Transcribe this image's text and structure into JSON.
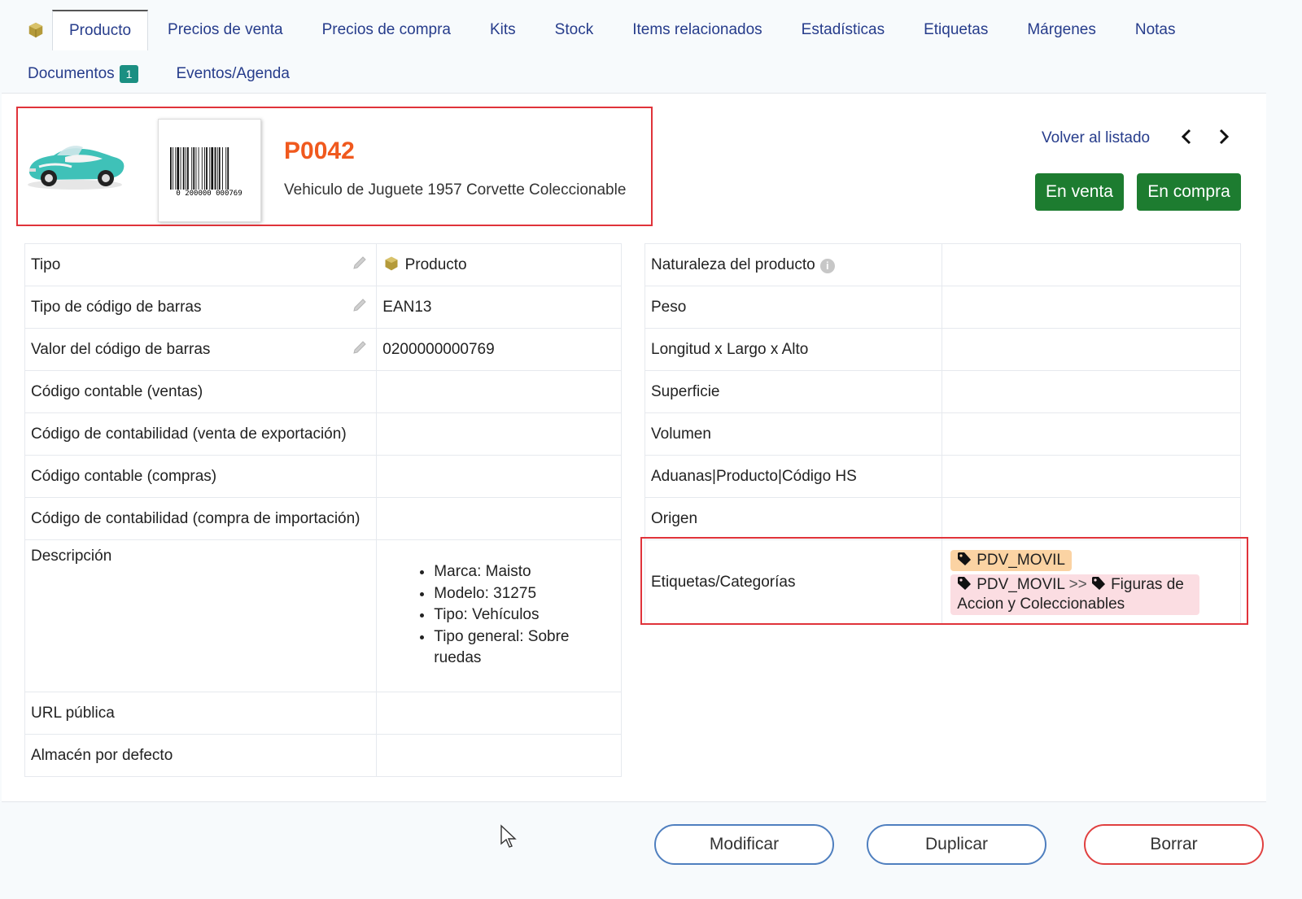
{
  "tabs_row1": [
    "Producto",
    "Precios de venta",
    "Precios de compra",
    "Kits",
    "Stock",
    "Items relacionados",
    "Estadísticas",
    "Etiquetas",
    "Márgenes",
    "Notas"
  ],
  "tabs_row2": {
    "documentos": "Documentos",
    "documentos_count": "1",
    "eventos": "Eventos/Agenda"
  },
  "product": {
    "ref": "P0042",
    "label": "Vehiculo de Juguete 1957 Corvette Coleccionable",
    "barcode_digits": "0 200000 000769"
  },
  "nav": {
    "back": "Volver al listado"
  },
  "status": {
    "sell": "En venta",
    "buy": "En compra"
  },
  "left": {
    "tipo_k": "Tipo",
    "tipo_v": "Producto",
    "barcode_type_k": "Tipo de código de barras",
    "barcode_type_v": "EAN13",
    "barcode_value_k": "Valor del código de barras",
    "barcode_value_v": "0200000000769",
    "acc_sell_k": "Código contable (ventas)",
    "acc_export_k": "Código de contabilidad (venta de exportación)",
    "acc_buy_k": "Código contable (compras)",
    "acc_import_k": "Código de contabilidad (compra de importación)",
    "desc_k": "Descripción",
    "desc_items": [
      "Marca: Maisto",
      "Modelo: 31275",
      "Tipo: Vehículos",
      "Tipo general: Sobre ruedas"
    ],
    "url_k": "URL pública",
    "warehouse_k": "Almacén por defecto"
  },
  "right": {
    "nature_k": "Naturaleza del producto",
    "weight_k": "Peso",
    "dims_k": "Longitud x Largo x Alto",
    "surface_k": "Superficie",
    "volume_k": "Volumen",
    "hs_k": "Aduanas|Producto|Código HS",
    "origin_k": "Origen",
    "tags_k": "Etiquetas/Categorías",
    "tag1": "PDV_MOVIL",
    "tag2_a": "PDV_MOVIL",
    "tag2_sep": ">>",
    "tag2_b": "Figuras de Accion y Coleccionables"
  },
  "actions": {
    "modify": "Modificar",
    "duplicate": "Duplicar",
    "delete": "Borrar"
  },
  "colors": {
    "ref": "#f0591e",
    "green": "#1d7c30",
    "link": "#263c8b",
    "highlight": "#e0333a"
  }
}
